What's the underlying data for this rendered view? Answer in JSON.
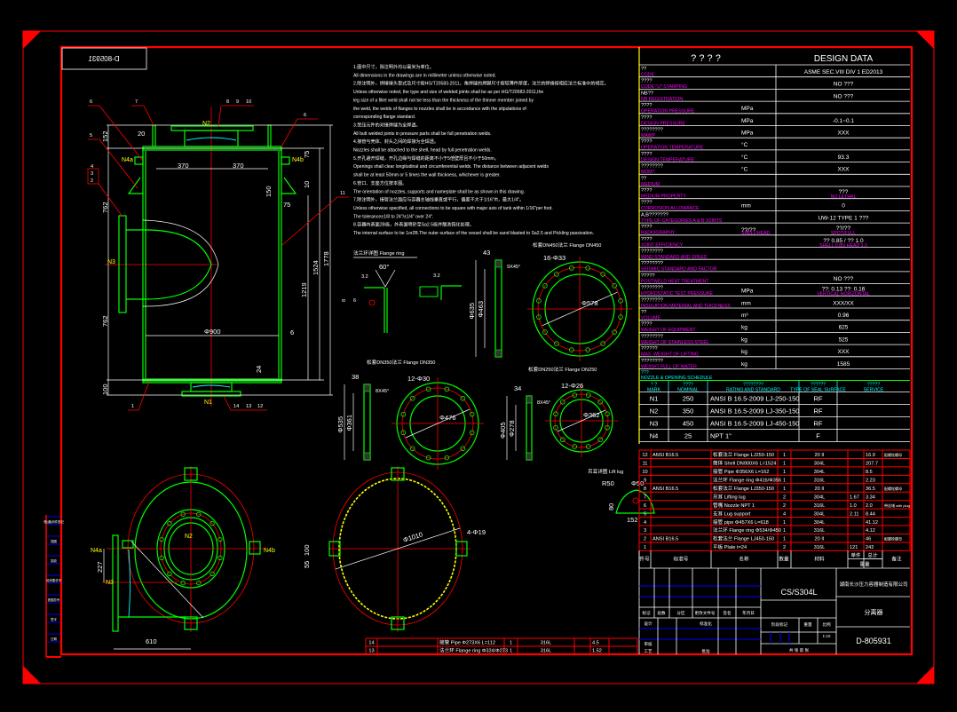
{
  "drawing_number_mirrored": "D-805931",
  "colors": {
    "background": "#000000",
    "frame": "#ff0000",
    "outline": "#00ff00",
    "centerline": "#ff0000",
    "dimension": "#ffffff",
    "nozzle_label": "#ffff00",
    "english_label": "#ff00ff",
    "schedule_header": "#00ffff"
  },
  "notes": [
    "1.图中尺寸，除注明外均以毫米为单位。",
    "All dimensions in the drawings are in millimeter unless otherwise noted.",
    "2.除注明外，焊接接头型式及尺寸按HG/T20583-2011，角焊缝的焊脚尺寸按较薄件厚度，法兰的焊接按相应法兰标准中的规定。",
    "Unless otherwise noted, the type and size of welded joints shall be as per HG/T20583-2011,the",
    "leg size of a fillet weld shall not be less than the thickness of the thinner member joined by",
    "the weld, the welds of flanges to nozzles shall be in accordance with the stipulations of",
    "corresponding flange standard.",
    "3.受压元件的对接焊缝为全焊透。",
    "All butt welded joints in pressure parts shall be full penetration welds.",
    "4.接管与壳体、封头之间的焊接为全焊透。",
    "Nozzles shall be attached to the shell, head by full penetration welds.",
    "5.开孔避开焊缝，开孔边缘与焊缝的距离不小于5倍壁厚且不小于50mm。",
    "Openings shall clear longitudinal and circumferential welds. The distance between adjacent welds",
    "shall be at least 50mm or 5 times the wall thickness, whichever is greater.",
    "6.管口、支座方位按本图。",
    "The orientation of nozzles, supports and nameplate shall be as shown in this drawing.",
    "7.除注明外，接管法兰面应与容器主轴线垂直或平行，偏差不大于1/16\"/ft，最大1/4\"。",
    "Unless otherwise specified, all connections to be square with major axis of tank within 1/16\"per foot.",
    "The tolerance±1/8 to 24\"/±1/4\" over 24\".",
    "8.容器内表面2B级，外表面喷砂至Sa2.5级并酸洗钝化处理。",
    "The internal surface to be 1or2B.The outer surface of the vessel shall be sand blasted to Sa2.5 and Pickling passivation."
  ],
  "design_data": {
    "header_cn": "?   ?   ?   ?",
    "header_en": "DESIGN     DATA",
    "rows": [
      {
        "cn": "??",
        "en": "CODE",
        "unit": "",
        "value": "ASME SEC.VIII DIV 1 ED2013"
      },
      {
        "cn": "????",
        "en": "CODE \"U\" STAMPING",
        "unit": "",
        "value": "NO      ???"
      },
      {
        "cn": "NB??",
        "en": "NB REGISTRATION",
        "unit": "",
        "value": "NO      ???"
      },
      {
        "cn": "????",
        "en": "OPERATION PRESSURE",
        "unit": "MPa",
        "value": ""
      },
      {
        "cn": "????",
        "en": "DESIGN PRESSURE",
        "unit": "MPa",
        "value": "-0.1~0.1"
      },
      {
        "cn": "????????",
        "en": "MAWP",
        "unit": "MPa",
        "value": "XXX"
      },
      {
        "cn": "????",
        "en": "OPERATION TEMPERATURE",
        "unit": "°C",
        "value": ""
      },
      {
        "cn": "????",
        "en": "DESIGN TEMPERATURE",
        "unit": "°C",
        "value": "93.3"
      },
      {
        "cn": "????????",
        "en": "MDMT",
        "unit": "°C",
        "value": "XXX"
      },
      {
        "cn": "??",
        "en": "MEDIUM",
        "unit": "",
        "value": ""
      },
      {
        "cn": "????",
        "en": "MEDIUM PROPERTY",
        "unit": "",
        "value": "???",
        "value_sub": "NO LETHAL"
      },
      {
        "cn": "????",
        "en": "CORROSION ALLOWANCE",
        "unit": "mm",
        "value": "0"
      },
      {
        "cn": "A,B???????",
        "en": "TYPE OF CATEGORIES A & B JOINTS",
        "unit": "",
        "value": "UW-12 TYPE 1     ???"
      },
      {
        "cn": "????",
        "en": "RADIOGRAPHY",
        "unit": "??/??",
        "unit_sub": "SHELL/HEAD",
        "value": "??/??",
        "value_sub": "SPOT/FULL"
      },
      {
        "cn": "????",
        "en": "JOINT EFFICIENCY",
        "unit": "",
        "value": "??  0.85  /  ??  1.0",
        "value_sub": "SHELL  0.85/ HEAD  1.0"
      },
      {
        "cn": "????????",
        "en": "WIND STANDARD AND SPEED",
        "unit": "",
        "value": ""
      },
      {
        "cn": "????????",
        "en": "SEISMIC STANDARD AND FACTOR",
        "unit": "",
        "value": ""
      },
      {
        "cn": "?????",
        "en": "POSTWELD HEAT TREATMENT",
        "unit": "",
        "value": "NO      ???"
      },
      {
        "cn": "????????",
        "en": "HYDROSTATIC TEST PRESSURE",
        "unit": "MPa",
        "value": "??: 0.13        ??: 0.16",
        "value_sub": "VERTICAL          HORIZONTAL"
      },
      {
        "cn": "????????",
        "en": "INSULATION MATERIAL AND THICKNESS",
        "unit": "mm",
        "value": "XXX/XX"
      },
      {
        "cn": "??",
        "en": "VOLUME",
        "unit": "m³",
        "value": "0.96"
      },
      {
        "cn": "????",
        "en": "WEIGHT OF EQUIPMENT",
        "unit": "kg",
        "value": "625"
      },
      {
        "cn": "????????",
        "en": "WEIGHT OF STAINLESS STEEL",
        "unit": "kg",
        "value": "525"
      },
      {
        "cn": "??????",
        "en": "MAX. WEIGHT OF LIFTING",
        "unit": "kg",
        "value": "XXX"
      },
      {
        "cn": "????????",
        "en": "WEIGHT FULL OF WATER",
        "unit": "kg",
        "value": "1585"
      }
    ]
  },
  "nozzle_schedule": {
    "title_cn": "???",
    "title_en": "NOZZLE & OPENING SCHEDULE",
    "columns": [
      {
        "cn": "? ?",
        "en": "MARK"
      },
      {
        "cn": "????",
        "en": "NOMINAL"
      },
      {
        "cn": "????????",
        "en": "RATING AND STANDARD"
      },
      {
        "cn": "??????",
        "en": "TYPE OF SEAL SURFACE"
      },
      {
        "cn": "?????",
        "en": "SERVICE"
      }
    ],
    "rows": [
      [
        "N1",
        "250",
        "ANSI B 16.5-2009  LJ-250-150",
        "RF",
        ""
      ],
      [
        "N2",
        "350",
        "ANSI B 16.5-2009  LJ-350-150",
        "RF",
        ""
      ],
      [
        "N3",
        "450",
        "ANSI B 16.5-2009  LJ-450-150",
        "RF",
        ""
      ],
      [
        "N4",
        "25",
        "NPT 1\"",
        "F",
        ""
      ]
    ]
  },
  "parts_list": {
    "rows": [
      [
        "14",
        "",
        "接管 Pipe Φ273X6 L=112",
        "1",
        "316L",
        "",
        "4.5",
        ""
      ],
      [
        "13",
        "",
        "法兰环 Flange ring Φ324/Φ273",
        "1",
        "316L",
        "",
        "1.52",
        ""
      ],
      [
        "12",
        "ANSI B16.5",
        "松套法兰 Flange LJ250-150",
        "1",
        "20 II",
        "",
        "16.9",
        "配螺栓螺母"
      ],
      [
        "11",
        "",
        "筒体 Shell DN900X6 L=1524",
        "1",
        "304L",
        "",
        "207.7",
        ""
      ],
      [
        "10",
        "",
        "接管 Pipe Φ356X6 L=162",
        "1",
        "304L",
        "",
        "8.5",
        ""
      ],
      [
        "9",
        "",
        "法兰环 Flange ring Φ416/Φ356",
        "1",
        "316L",
        "",
        "2.23",
        ""
      ],
      [
        "8",
        "ANSI B16.5",
        "松套法兰 Flange LJ350-150",
        "1",
        "20 II",
        "",
        "36.5",
        "配螺栓螺母"
      ],
      [
        "7",
        "",
        "吊耳 Lifting lug",
        "2",
        "304L",
        "1.67",
        "3.34",
        ""
      ],
      [
        "6",
        "",
        "管嘴 Nozzle NPT 1",
        "2",
        "316L",
        "1.0",
        "2.0",
        "带丝堵 with plug"
      ],
      [
        "5",
        "",
        "支耳 Lug support",
        "4",
        "304L",
        "2.11",
        "8.44",
        ""
      ],
      [
        "4",
        "",
        "接管 pipe Φ457X6 L=618",
        "1",
        "304L",
        "",
        "41.12",
        ""
      ],
      [
        "3",
        "",
        "法兰环 Flange ring Φ534/Φ450",
        "1",
        "316L",
        "",
        "4.12",
        ""
      ],
      [
        "2",
        "ANSI B16.5",
        "松套法兰 Flange LJ450-150",
        "1",
        "20 II",
        "",
        "46",
        "配螺栓螺母"
      ],
      [
        "1",
        "",
        "平板 Plate t=24",
        "2",
        "316L",
        "121",
        "242",
        ""
      ]
    ],
    "header": {
      "mark": "件号",
      "standard": "标准号",
      "name": "名称",
      "qty": "数量",
      "material": "材料",
      "unit_weight": "单件",
      "total_weight": "总计",
      "weight": "重量",
      "remark": "备注"
    }
  },
  "title_block": {
    "material": "CS/S304L",
    "company": "湖南长沙压力容器制造有限公司",
    "drawing_name": "分离器",
    "drawing_number": "D-805931",
    "scale": "1:10",
    "labels": {
      "mark": "标记",
      "count": "处数",
      "zone": "分区",
      "change_doc": "更改文件号",
      "sign": "签名",
      "date": "年月日",
      "design": "设计",
      "standardize": "标准化",
      "check": "审核",
      "process": "工艺",
      "approve": "批准",
      "stage": "阶段标记",
      "weight": "重量",
      "ratio": "比例",
      "sheets": "共   张  第   张"
    }
  },
  "side_stamps": [
    "借(通)用件登记",
    "描图",
    "描校",
    "旧底图总号",
    "底图总号",
    "签字",
    "日期"
  ],
  "flanges": [
    {
      "title": "松套DN450法兰 Flange DN450",
      "bolts": "16-Φ33",
      "bolt_count": 16,
      "bcd": "Φ578",
      "od": "Φ635",
      "id": "Φ463",
      "thk": "43",
      "chamfer": "9X45°"
    },
    {
      "title": "松套DN350法兰 Flange DN350",
      "bolts": "12-Φ30",
      "bolt_count": 12,
      "bcd": "Φ476",
      "od": "Φ535",
      "id": "Φ361",
      "thk": "38",
      "chamfer": "8X45°"
    },
    {
      "title": "松套DN250法兰 Flange DN250",
      "bolts": "12-Φ26",
      "bolt_count": 12,
      "bcd": "Φ362",
      "od": "Φ405",
      "id": "Φ278",
      "thk": "34",
      "chamfer": "8X45°"
    }
  ],
  "flange_ring_detail": {
    "title": "法兰环详图 Flange ring",
    "angle": "60°",
    "weld1": "3.2",
    "weld2": "6",
    "weld3": "3.2",
    "thk": "8"
  },
  "lift_lug": {
    "title": "吊耳详图 Lift lug",
    "r": "R50",
    "hole": "Φ50",
    "h": "80",
    "w": "152"
  },
  "elevation": {
    "dims": {
      "d20": "20",
      "d370a": "370",
      "d370b": "370",
      "d152": "152",
      "d762a": "762",
      "d762b": "762",
      "d1524": "1524",
      "d1778": "1778",
      "d1219": "1219",
      "dia900": "Φ900",
      "d6": "6",
      "d24": "24",
      "d100": "100",
      "d150": "150",
      "d10": "10",
      "d75a": "75",
      "d75b": "75"
    },
    "parts": {
      "p1": "1",
      "p2": "2",
      "p3": "3",
      "p4": "4",
      "p5": "5",
      "p6a": "6",
      "p6b": "6",
      "p7": "7",
      "p8": "8",
      "p9": "9",
      "p10": "10",
      "p11": "11",
      "p12": "12",
      "p13": "13",
      "p14": "14"
    },
    "nozzles": {
      "n1": "N1",
      "n2": "N2",
      "n3": "N3",
      "n4a": "N4a",
      "n4b": "N4b"
    }
  },
  "plan": {
    "n2": "N2",
    "n3": "N3",
    "n4a": "N4a",
    "n4b": "N4b",
    "d227": "227",
    "d610": "610"
  },
  "support_ring": {
    "dia": "Φ1010",
    "holes": "4-Φ19",
    "h100": "100",
    "h55": "55"
  }
}
